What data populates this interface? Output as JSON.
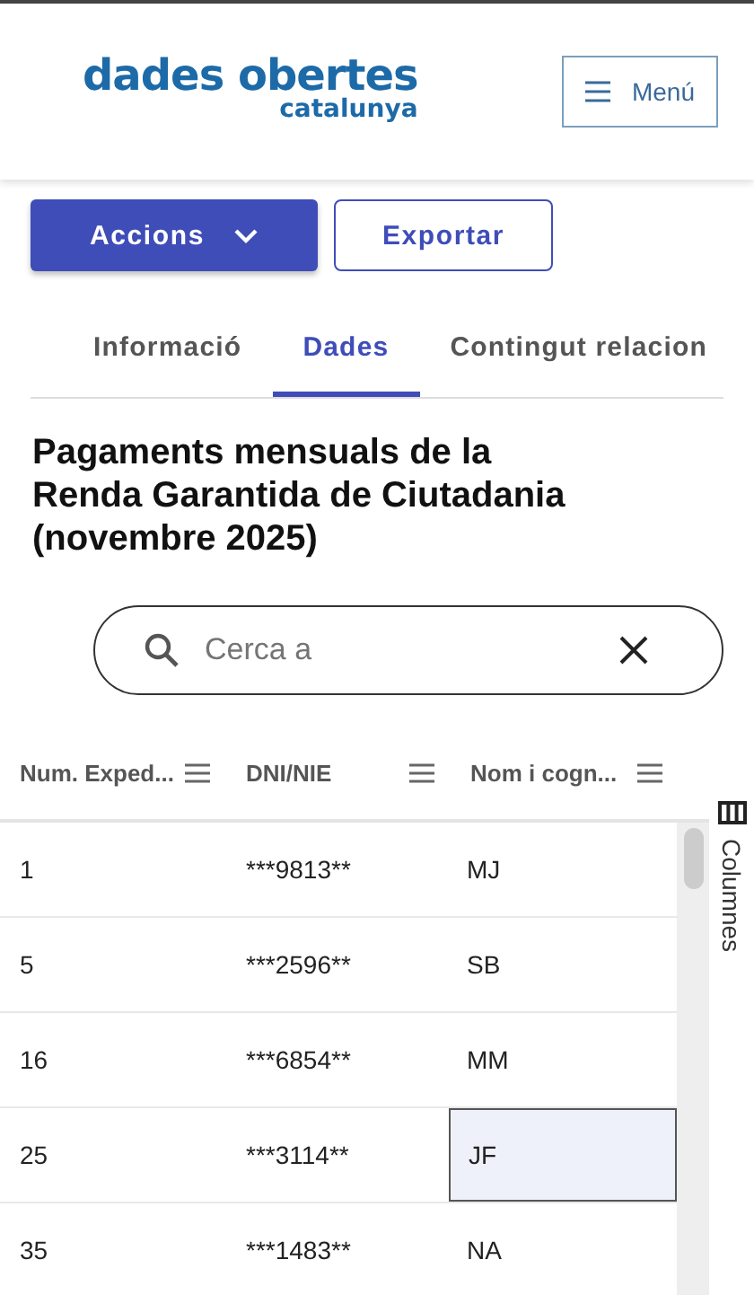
{
  "header": {
    "logo_title": "dades obertes",
    "logo_subtitle": "catalunya",
    "menu_button": "Menú"
  },
  "actions": {
    "primary": "Accions",
    "secondary": "Exportar"
  },
  "tabs": [
    {
      "label": "Informació",
      "selected": false
    },
    {
      "label": "Dades",
      "selected": true
    },
    {
      "label": "Contingut relacion",
      "selected": false
    }
  ],
  "title": "Pagaments mensuals de la Renda Garantida de Ciutadania (novembre 2025)",
  "search": {
    "placeholder": "Cerca a"
  },
  "table": {
    "columns": [
      "Num. Exped...",
      "DNI/NIE",
      "Nom i cogn..."
    ],
    "rows": [
      [
        {
          "text": "1",
          "selected": false
        },
        {
          "text": "***9813**",
          "selected": false
        },
        {
          "text": "MJ",
          "selected": false
        }
      ],
      [
        {
          "text": "5",
          "selected": false
        },
        {
          "text": "***2596**",
          "selected": false
        },
        {
          "text": "SB",
          "selected": false
        }
      ],
      [
        {
          "text": "16",
          "selected": false
        },
        {
          "text": "***6854**",
          "selected": false
        },
        {
          "text": "MM",
          "selected": false
        }
      ],
      [
        {
          "text": "25",
          "selected": false
        },
        {
          "text": "***3114**",
          "selected": false
        },
        {
          "text": "JF",
          "selected": true
        }
      ],
      [
        {
          "text": "35",
          "selected": false
        },
        {
          "text": "***1483**",
          "selected": false
        },
        {
          "text": "NA",
          "selected": false
        }
      ]
    ]
  },
  "side_panel": {
    "label": "Columnes"
  }
}
